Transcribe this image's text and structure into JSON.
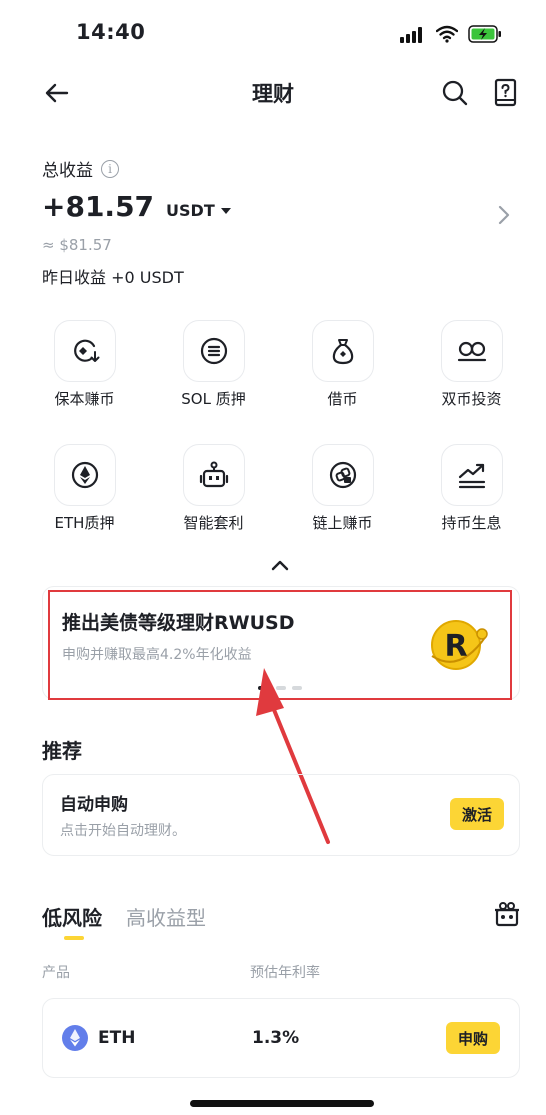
{
  "status_bar": {
    "time": "14:40"
  },
  "header": {
    "title": "理财"
  },
  "summary": {
    "label": "总收益",
    "info_glyph": "i",
    "amount": "+81.57",
    "unit": "USDT",
    "approx": "≈ $81.57",
    "yesterday": "昨日收益 +0 USDT"
  },
  "grid": [
    {
      "label": "保本赚币",
      "icon": "coin-down-icon"
    },
    {
      "label": "SOL 质押",
      "icon": "sol-icon"
    },
    {
      "label": "借币",
      "icon": "bag-icon"
    },
    {
      "label": "双币投资",
      "icon": "dual-coin-icon"
    },
    {
      "label": "ETH质押",
      "icon": "eth-icon"
    },
    {
      "label": "智能套利",
      "icon": "robot-icon"
    },
    {
      "label": "链上赚币",
      "icon": "onchain-icon"
    },
    {
      "label": "持币生息",
      "icon": "growth-chart-icon"
    }
  ],
  "banner": {
    "title": "推出美债等级理财RWUSD",
    "subtitle": "申购并赚取最高4.2%年化收益",
    "logo_letter": "R",
    "active_slide": 1,
    "slide_count": 3
  },
  "recommend": {
    "title": "推荐",
    "card_title": "自动申购",
    "card_subtitle": "点击开始自动理财。",
    "button": "激活"
  },
  "tabs": [
    {
      "label": "低风险",
      "active": true
    },
    {
      "label": "高收益型",
      "active": false
    }
  ],
  "table": {
    "col_product": "产品",
    "col_apr": "预估年利率",
    "rows": [
      {
        "coin": "ETH",
        "apr": "1.3%",
        "button": "申购"
      }
    ]
  },
  "colors": {
    "accent": "#fcd535",
    "text": "#1e2026",
    "muted": "#9aa0a8",
    "highlight": "#e03a3e",
    "eth": "#627eea"
  }
}
